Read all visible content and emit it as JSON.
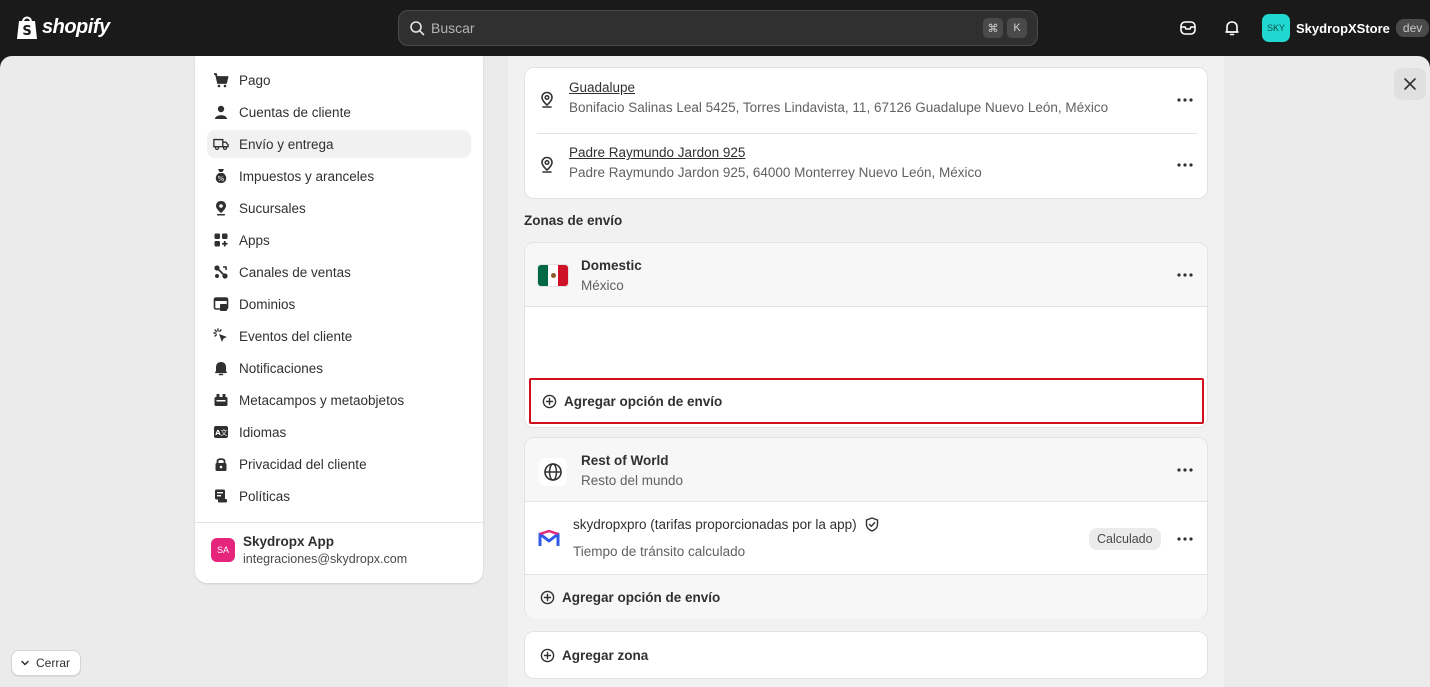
{
  "topbar": {
    "brand": "shopify",
    "search_placeholder": "Buscar",
    "shortcut_cmd": "⌘",
    "shortcut_key": "K",
    "store_avatar": "SKY",
    "store_name": "SkydropXStore",
    "store_badge": "dev"
  },
  "sidebar": {
    "items": [
      {
        "label": "Pago",
        "icon": "cart-icon"
      },
      {
        "label": "Cuentas de cliente",
        "icon": "person-icon"
      },
      {
        "label": "Envío y entrega",
        "icon": "truck-icon"
      },
      {
        "label": "Impuestos y aranceles",
        "icon": "tax-icon"
      },
      {
        "label": "Sucursales",
        "icon": "location-icon"
      },
      {
        "label": "Apps",
        "icon": "apps-icon"
      },
      {
        "label": "Canales de ventas",
        "icon": "channels-icon"
      },
      {
        "label": "Dominios",
        "icon": "domains-icon"
      },
      {
        "label": "Eventos del cliente",
        "icon": "cursor-icon"
      },
      {
        "label": "Notificaciones",
        "icon": "bell-icon"
      },
      {
        "label": "Metacampos y metaobjetos",
        "icon": "metafields-icon"
      },
      {
        "label": "Idiomas",
        "icon": "language-icon"
      },
      {
        "label": "Privacidad del cliente",
        "icon": "lock-icon"
      },
      {
        "label": "Políticas",
        "icon": "policies-icon"
      }
    ],
    "app": {
      "avatar": "SA",
      "name": "Skydropx App",
      "email": "integraciones@skydropx.com"
    }
  },
  "main": {
    "locations": [
      {
        "name": "Guadalupe",
        "address": "Bonifacio Salinas Leal 5425, Torres Lindavista, 11, 67126 Guadalupe Nuevo León, México"
      },
      {
        "name": "Padre Raymundo Jardon 925",
        "address": "Padre Raymundo Jardon 925, 64000 Monterrey Nuevo León, México"
      }
    ],
    "zones_title": "Zonas de envío",
    "zones": [
      {
        "name": "Domestic",
        "region": "México",
        "add_option": "Agregar opción de envío"
      },
      {
        "name": "Rest of World",
        "region": "Resto del mundo",
        "rate_title": "skydropxpro (tarifas proporcionadas por la app)",
        "rate_sub": "Tiempo de tránsito calculado",
        "rate_badge": "Calculado",
        "add_option": "Agregar opción de envío"
      }
    ],
    "add_zone": "Agregar zona"
  },
  "footer": {
    "close_label": "Cerrar"
  },
  "colors": {
    "highlight": "#d0101e",
    "mx_green": "#006847",
    "mx_red": "#ce1126",
    "store_avatar": "#21d8d0",
    "app_avatar": "#e5257c"
  }
}
